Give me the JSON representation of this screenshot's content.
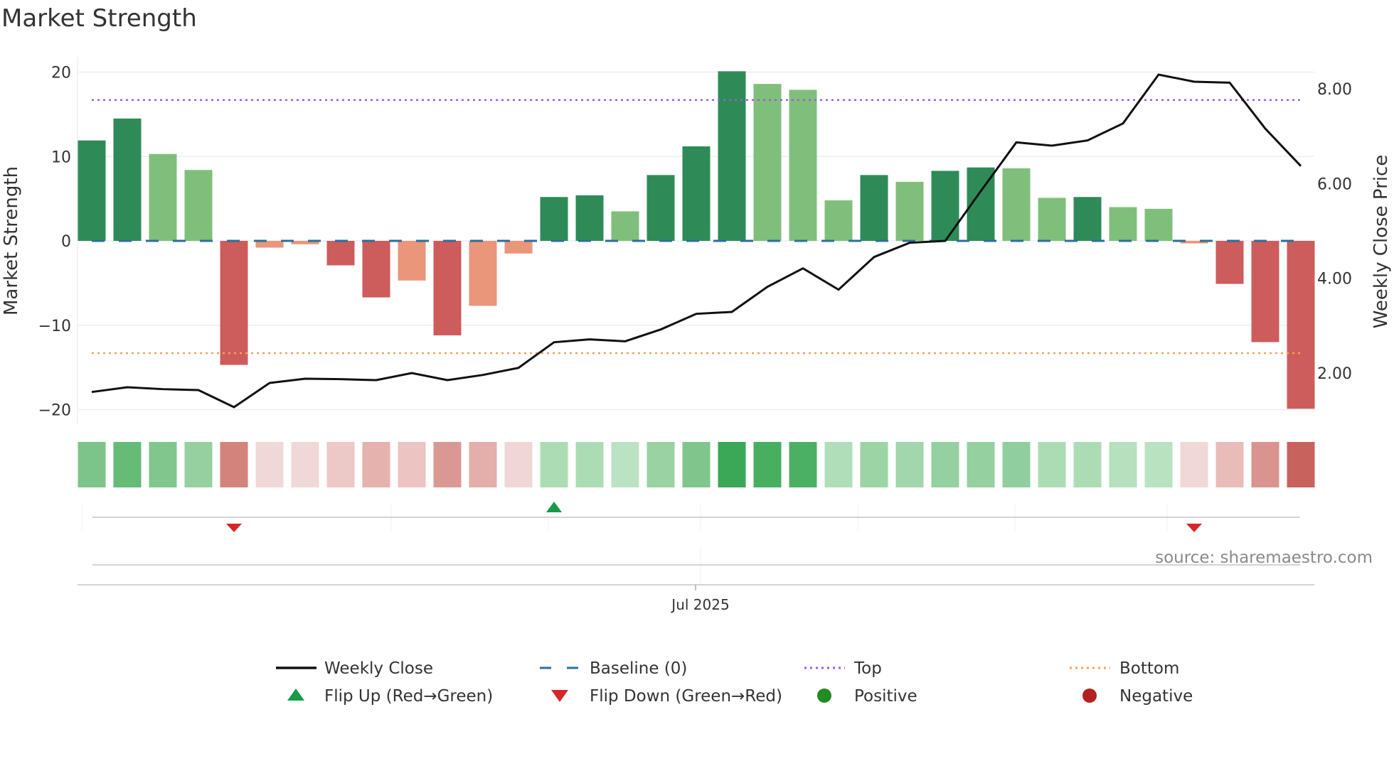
{
  "chart_data": {
    "type": "bar",
    "title": "Market Strength",
    "ylabel": "Market Strength",
    "y2label": "Weekly Close Price",
    "ylim": [
      -22,
      22
    ],
    "y2lim": [
      1.0,
      8.6
    ],
    "yticks": [
      20,
      10,
      0,
      -10,
      -20
    ],
    "ytick_labels": [
      "20",
      "10",
      "0",
      "−10",
      "−20"
    ],
    "y2ticks": [
      8,
      6,
      4,
      2
    ],
    "y2tick_labels": [
      "8.00",
      "6.00",
      "4.00",
      "2.00"
    ],
    "xtick_label": "Jul 2025",
    "xtick_index": 17,
    "grid": true,
    "top_level": 16.7,
    "bottom_level": -13.3,
    "series": [
      {
        "name": "Market Strength",
        "type": "bar",
        "values": [
          11.9,
          14.5,
          10.3,
          8.4,
          -14.7,
          -0.8,
          -0.4,
          -2.9,
          -6.7,
          -4.7,
          -11.2,
          -7.7,
          -1.5,
          5.2,
          5.4,
          3.5,
          7.8,
          11.2,
          20.1,
          18.6,
          17.9,
          4.8,
          7.8,
          7.0,
          8.3,
          8.7,
          8.6,
          5.1,
          5.2,
          4.0,
          3.8,
          -0.3,
          -5.1,
          -12.0,
          -19.9
        ],
        "strong": [
          1,
          1,
          0,
          0,
          1,
          0,
          0,
          1,
          1,
          0,
          1,
          0,
          0,
          1,
          1,
          0,
          1,
          1,
          1,
          0,
          0,
          0,
          1,
          0,
          1,
          1,
          0,
          0,
          1,
          0,
          0,
          0,
          1,
          1,
          1
        ]
      },
      {
        "name": "Weekly Close",
        "type": "line",
        "axis": "right",
        "values": [
          1.6,
          1.7,
          1.66,
          1.64,
          1.28,
          1.79,
          1.88,
          1.87,
          1.85,
          2.0,
          1.85,
          1.96,
          2.11,
          2.65,
          2.71,
          2.67,
          2.92,
          3.25,
          3.29,
          3.82,
          4.21,
          3.76,
          4.45,
          4.75,
          4.79,
          5.84,
          6.87,
          6.8,
          6.91,
          7.27,
          8.3,
          8.15,
          8.13,
          7.16,
          6.37
        ]
      }
    ],
    "heat_strip": [
      "#7cc48a",
      "#66bb77",
      "#80c68d",
      "#96d0a0",
      "#d4827c",
      "#f0d8d8",
      "#f0d8d8",
      "#ecc8c6",
      "#e6b2ae",
      "#ecc4c2",
      "#da9894",
      "#e4aeab",
      "#f0d6d6",
      "#acdcb4",
      "#acdcb4",
      "#bce2c4",
      "#9ad2a4",
      "#80c68c",
      "#3aa856",
      "#48ae60",
      "#4cb064",
      "#b0deb8",
      "#9cd4a6",
      "#a2d6ac",
      "#94d0a0",
      "#94d0a0",
      "#90cea0",
      "#acdcb4",
      "#acdcb4",
      "#b6e0be",
      "#b8e2c0",
      "#f0d8d8",
      "#e8bcb8",
      "#da948f",
      "#c8625c"
    ],
    "flips": [
      {
        "index": 4,
        "dir": "down"
      },
      {
        "index": 13,
        "dir": "up"
      },
      {
        "index": 31,
        "dir": "down"
      }
    ],
    "legend": {
      "placement": "bottom",
      "items": [
        {
          "label": "Weekly Close",
          "kind": "line-solid",
          "color": "#111111"
        },
        {
          "label": "Baseline (0)",
          "kind": "line-dash",
          "color": "#2a6f9e"
        },
        {
          "label": "Top",
          "kind": "line-dot",
          "color": "#9b5de5"
        },
        {
          "label": "Bottom",
          "kind": "line-dot",
          "color": "#f4a259"
        },
        {
          "label": "Flip Up (Red→Green)",
          "kind": "tri-up",
          "color": "#1a9a48"
        },
        {
          "label": "Flip Down (Green→Red)",
          "kind": "tri-down",
          "color": "#d62728"
        },
        {
          "label": "Positive",
          "kind": "dot",
          "color": "#228b22"
        },
        {
          "label": "Negative",
          "kind": "dot",
          "color": "#b22222"
        }
      ]
    },
    "colors": {
      "pos_strong": "#2e8b57",
      "pos_weak": "#7fbf7b",
      "neg_strong": "#cd5c5c",
      "neg_weak": "#e9967a"
    }
  },
  "source": "source: sharemaestro.com"
}
